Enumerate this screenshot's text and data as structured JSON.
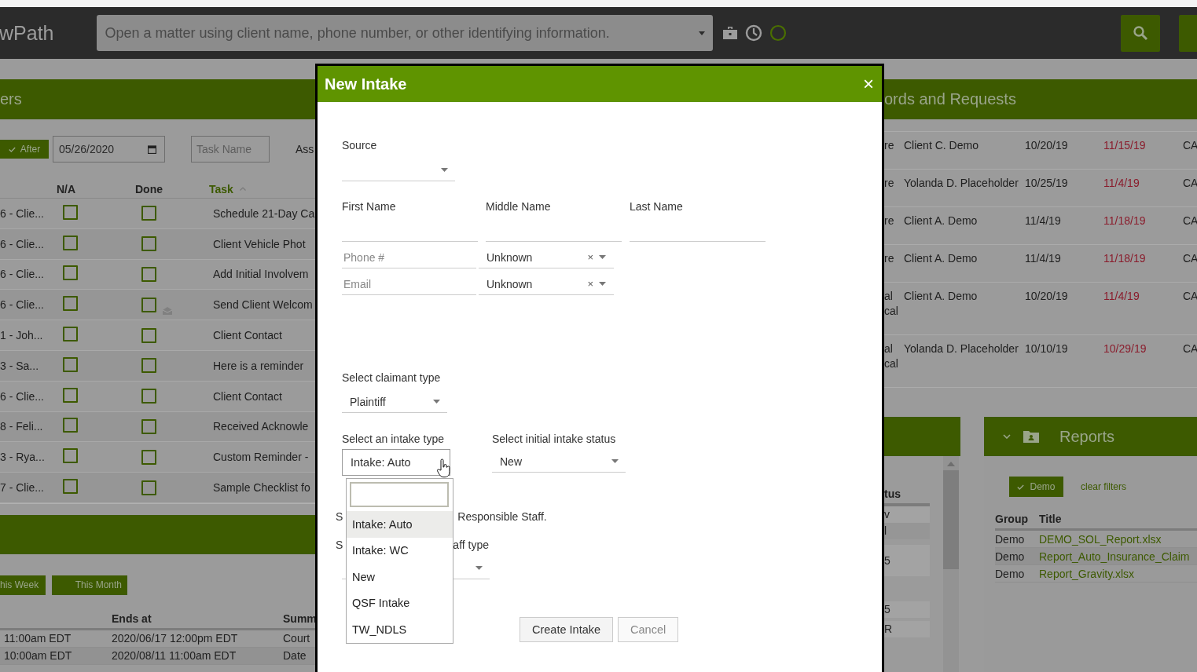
{
  "app": {
    "logo": "wPath",
    "search": {
      "placeholder": "Open a matter using client name, phone number, or other identifying information."
    }
  },
  "tasks_panel": {
    "title": "ers",
    "after": {
      "label": "After",
      "checked": true
    },
    "date": "05/26/2020",
    "task_name": {
      "placeholder": "Task Name"
    },
    "assignee_label": "Ass",
    "columns": [
      {
        "label": "N/A",
        "sorted": false
      },
      {
        "label": "Done",
        "sorted": false
      },
      {
        "label": "Task",
        "sorted": true
      }
    ],
    "rows": [
      {
        "matter": "6 - Clie...",
        "na": false,
        "done": false,
        "has_message": false,
        "task": "Schedule 21-Day Ca"
      },
      {
        "matter": "6 - Clie...",
        "na": false,
        "done": false,
        "has_message": false,
        "task": "Client Vehicle Phot"
      },
      {
        "matter": "6 - Clie...",
        "na": false,
        "done": false,
        "has_message": false,
        "task": "Add Initial Involvem"
      },
      {
        "matter": "6 - Clie...",
        "na": false,
        "done": false,
        "has_message": true,
        "task": "Send Client Welcom"
      },
      {
        "matter": "1 - Joh...",
        "na": false,
        "done": false,
        "has_message": false,
        "task": "Client Contact"
      },
      {
        "matter": "3 - Sa...",
        "na": false,
        "done": false,
        "has_message": false,
        "task": "Here is a reminder"
      },
      {
        "matter": "6 - Clie...",
        "na": false,
        "done": false,
        "has_message": false,
        "task": "Client Contact"
      },
      {
        "matter": "8 - Feli...",
        "na": false,
        "done": false,
        "has_message": false,
        "task": "Received Acknowle"
      },
      {
        "matter": "3 - Rya...",
        "na": false,
        "done": false,
        "has_message": false,
        "task": "Custom Reminder -"
      },
      {
        "matter": "7 - Clie...",
        "na": false,
        "done": false,
        "has_message": false,
        "task": "Sample Checklist fo"
      }
    ]
  },
  "events_panel": {
    "buttons": [
      "his Week",
      "This Month"
    ],
    "columns": [
      "Ends at",
      "Summ"
    ],
    "rows": [
      {
        "starts": "11:00am EDT",
        "ends": "2020/06/17 12:00pm EDT",
        "summary": "Court"
      },
      {
        "starts": "10:00am EDT",
        "ends": "2020/08/11 11:00am EDT",
        "summary": "Date"
      }
    ]
  },
  "records_panel": {
    "title": "ords and Requests",
    "rows": [
      {
        "column_1": "re",
        "name": "Client C. Demo",
        "date": "10/20/19",
        "due": "11/15/19",
        "column_5": "CA"
      },
      {
        "column_1": "re",
        "name": "Yolanda D. Placeholder",
        "date": "10/25/19",
        "due": "11/4/19",
        "column_5": "CA"
      },
      {
        "column_1": "re",
        "name": "Client A. Demo",
        "date": "11/4/19",
        "due": "11/18/19",
        "column_5": "CA"
      },
      {
        "column_1": "re",
        "name": "Client A. Demo",
        "date": "11/4/19",
        "due": "11/18/19",
        "column_5": "CA"
      },
      {
        "column_1": "al cal",
        "name": "Client A. Demo",
        "date": "10/20/19",
        "due": "11/4/19",
        "column_5": "CA"
      },
      {
        "column_1": "al cal",
        "name": "Yolanda D. Placeholder",
        "date": "10/10/19",
        "due": "10/29/19",
        "column_5": "CA"
      }
    ]
  },
  "status_panel": {
    "heading": "tus",
    "cells": [
      "v",
      "l",
      "5",
      "5",
      "R"
    ]
  },
  "reports_panel": {
    "title": "Reports",
    "filter": {
      "label": "Demo",
      "checked": true
    },
    "clear": "clear filters",
    "columns": [
      "Group",
      "Title"
    ],
    "rows": [
      {
        "group": "Demo",
        "title": "DEMO_SOL_Report.xlsx"
      },
      {
        "group": "Demo",
        "title": "Report_Auto_Insurance_Claim"
      },
      {
        "group": "Demo",
        "title": "Report_Gravity.xlsx"
      }
    ]
  },
  "dialog": {
    "title": "New Intake",
    "close": "×",
    "source": {
      "label": "Source"
    },
    "names": [
      {
        "label": "First Name"
      },
      {
        "label": "Middle Name"
      },
      {
        "label": "Last Name"
      }
    ],
    "contacts": [
      {
        "placeholder": "Phone #",
        "type": "Unknown",
        "clear": "×"
      },
      {
        "placeholder": "Email",
        "type": "Unknown",
        "clear": "×"
      }
    ],
    "claimant": {
      "label": "Select claimant type",
      "value": "Plaintiff"
    },
    "intake_type": {
      "label": "Select an intake type",
      "value": "Intake: Auto",
      "expanded": true,
      "options": [
        {
          "label": "Intake: Auto",
          "selected": true
        },
        {
          "label": "Intake: WC",
          "selected": false
        },
        {
          "label": "New",
          "selected": false
        },
        {
          "label": "QSF Intake",
          "selected": false
        },
        {
          "label": "TW_NDLS",
          "selected": false
        }
      ]
    },
    "intake_status": {
      "label": "Select initial intake status",
      "value": "New"
    },
    "staff_note": {
      "start": "S",
      "end": "Responsible Staff."
    },
    "staff_type": {
      "label_start": "S",
      "label_end": "aff type"
    },
    "buttons": [
      {
        "label": "Create Intake",
        "disabled": false
      },
      {
        "label": "Cancel",
        "disabled": true
      }
    ]
  }
}
